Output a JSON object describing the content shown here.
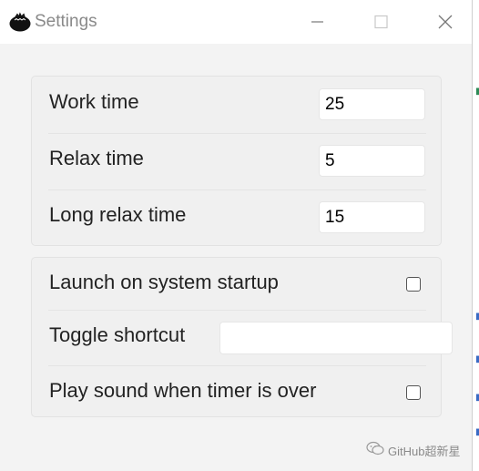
{
  "window": {
    "title": "Settings"
  },
  "timers": {
    "work_label": "Work time",
    "work_value": "25",
    "relax_label": "Relax time",
    "relax_value": "5",
    "long_relax_label": "Long relax time",
    "long_relax_value": "15"
  },
  "options": {
    "startup_label": "Launch on system startup",
    "startup_checked": false,
    "shortcut_label": "Toggle shortcut",
    "shortcut_value": "",
    "sound_label": "Play sound when timer is over",
    "sound_checked": false
  },
  "watermark": {
    "text": "GitHub超新星"
  },
  "colors": {
    "background": "#f3f3f3",
    "card": "#f0f0f0",
    "titlebar": "#ffffff",
    "title_text": "#8a8a8a"
  }
}
